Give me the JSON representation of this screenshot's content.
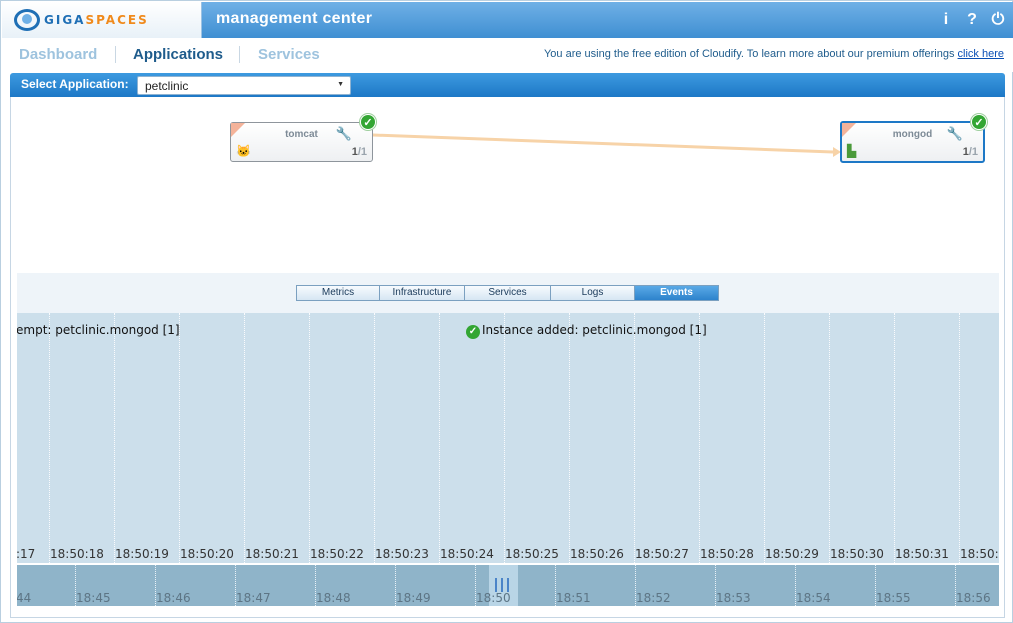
{
  "header": {
    "logo_giga": "GIGA",
    "logo_spaces": "SPACES",
    "title": "management center",
    "icons": {
      "info": "i",
      "help": "?",
      "power": "⏻"
    }
  },
  "nav": {
    "tabs": [
      "Dashboard",
      "Applications",
      "Services"
    ],
    "active_tab": "Applications",
    "promo_text": "You are using the free edition of Cloudify. To learn more about our premium offerings ",
    "promo_link": "click here"
  },
  "select_bar": {
    "label": "Select Application:",
    "value": "petclinic"
  },
  "topology": {
    "nodes": [
      {
        "name": "tomcat",
        "running": "1",
        "total": "/1",
        "icon": "tomcat-cat-icon",
        "status": "ok"
      },
      {
        "name": "mongod",
        "running": "1",
        "total": "/1",
        "icon": "mongodb-leaf-icon",
        "status": "ok",
        "selected": true
      }
    ],
    "link_color": "#f7d3a8"
  },
  "tabs": {
    "items": [
      "Metrics",
      "Infrastructure",
      "Services",
      "Logs",
      "Events"
    ],
    "active": "Events"
  },
  "events": {
    "items": [
      {
        "text": "empt: petclinic.mongod [1]",
        "status": "none"
      },
      {
        "text": "Instance added: petclinic.mongod [1]",
        "status": "ok"
      }
    ],
    "ticks": [
      ":17",
      "18:50:18",
      "18:50:19",
      "18:50:20",
      "18:50:21",
      "18:50:22",
      "18:50:23",
      "18:50:24",
      "18:50:25",
      "18:50:26",
      "18:50:27",
      "18:50:28",
      "18:50:29",
      "18:50:30",
      "18:50:31",
      "18:50:3"
    ]
  },
  "overview": {
    "ticks": [
      "44",
      "18:45",
      "18:46",
      "18:47",
      "18:48",
      "18:49",
      "18:50",
      "18:51",
      "18:52",
      "18:53",
      "18:54",
      "18:55",
      "18:56"
    ]
  },
  "colors": {
    "accent": "#1d78c6",
    "header": "#3f8fd2",
    "events_bg": "#ccdfeb",
    "overview_bg": "#8fb4c9",
    "ok_green": "#33a633"
  }
}
